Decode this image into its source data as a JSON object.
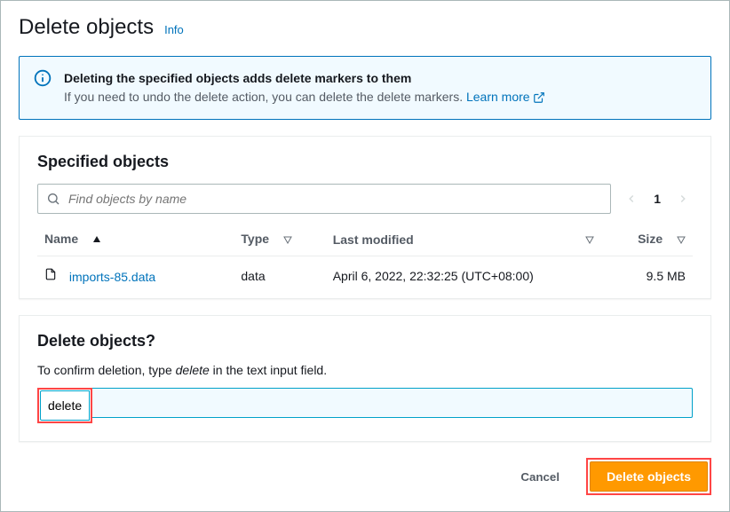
{
  "header": {
    "title": "Delete objects",
    "info": "Info"
  },
  "banner": {
    "title": "Deleting the specified objects adds delete markers to them",
    "desc_prefix": "If you need to undo the delete action, you can delete the delete markers. ",
    "learn": "Learn more"
  },
  "specified": {
    "title": "Specified objects",
    "search_placeholder": "Find objects by name",
    "page": "1",
    "columns": {
      "name": "Name",
      "type": "Type",
      "modified": "Last modified",
      "size": "Size"
    },
    "rows": [
      {
        "name": "imports-85.data",
        "type": "data",
        "modified": "April 6, 2022, 22:32:25 (UTC+08:00)",
        "size": "9.5 MB"
      }
    ]
  },
  "confirm": {
    "title": "Delete objects?",
    "desc_prefix": "To confirm deletion, type ",
    "desc_keyword": "delete",
    "desc_suffix": " in the text input field.",
    "value": "delete"
  },
  "footer": {
    "cancel": "Cancel",
    "submit": "Delete objects"
  }
}
